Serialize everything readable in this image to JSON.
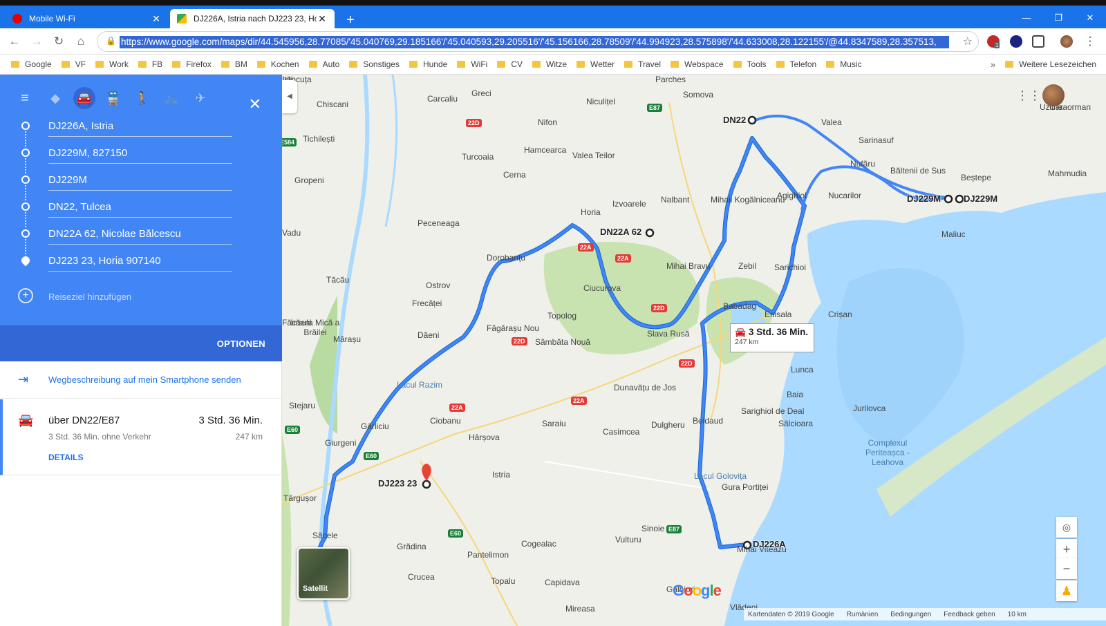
{
  "browser": {
    "tabs": [
      {
        "title": "Mobile Wi-Fi",
        "icon": "vodafone-icon",
        "active": false
      },
      {
        "title": "DJ226A, Istria nach DJ223 23, Ho",
        "icon": "google-maps-icon",
        "active": true
      }
    ],
    "url": "https://www.google.com/maps/dir/44.545956,28.77085/'45.040769,29.185166'/'45.040593,29.205516'/'45.156166,28.78509'/'44.994923,28.575898'/'44.633008,28.122155'/@44.8347589,28.357513,",
    "extension_badge": "1"
  },
  "bookmarks": [
    "Google",
    "VF",
    "Work",
    "FB",
    "Firefox",
    "BM",
    "Kochen",
    "Auto",
    "Sonstiges",
    "Hunde",
    "WiFi",
    "CV",
    "Witze",
    "Wetter",
    "Travel",
    "Webspace",
    "Tools",
    "Telefon",
    "Music"
  ],
  "bookmarks_overflow": "»",
  "bookmarks_other": "Weitere Lesezeichen",
  "directions": {
    "stops": [
      "DJ226A, Istria",
      "DJ229M, 827150",
      "DJ229M",
      "DN22, Tulcea",
      "DN22A 62, Nicolae Bălcescu",
      "DJ223 23, Horia 907140"
    ],
    "add_destination_placeholder": "Reiseziel hinzufügen",
    "options_label": "OPTIONEN",
    "send_to_phone": "Wegbeschreibung auf mein Smartphone senden",
    "route": {
      "via": "über DN22/E87",
      "time": "3 Std. 36 Min.",
      "subtitle": "3 Std. 36 Min. ohne Verkehr",
      "distance": "247 km",
      "details_label": "DETAILS"
    }
  },
  "map": {
    "route_color": "#4285f4",
    "water_color": "#aadaff",
    "info_time": "3 Std. 36 Min.",
    "info_distance": "247 km",
    "waypoint_labels": [
      "DN22",
      "DN22A 62",
      "DJ229M",
      "DJ229M",
      "DJ223 23",
      "DJ226A"
    ],
    "place_labels": [
      "Parches",
      "Somova",
      "Niculițel",
      "Greci",
      "Carcaliu",
      "Chiscani",
      "Tichilești",
      "Nifon",
      "Hamcearca",
      "Valea Teilor",
      "Turcoaia",
      "Gropeni",
      "Cerna",
      "Horia",
      "Izvoarele",
      "Nalbant",
      "Mihail Kogălniceanu",
      "Peceneaga",
      "Dorobanțu",
      "Mihai Bravu",
      "Zebil",
      "Ciucurova",
      "Ostrov",
      "Frecăței",
      "Tăcău",
      "Insula Mică a Brăilei",
      "Mărașu",
      "Făgărașu Nou",
      "Topolog",
      "Dăeni",
      "Sâmbăta Nouă",
      "Slava Rusă",
      "Babadag",
      "Enisala",
      "Sarichioi",
      "Agighiol",
      "Nucarilor",
      "Valea",
      "Sarinasuf",
      "Nufăru",
      "Băltenii de Sus",
      "Beștepe",
      "Mahmudia",
      "Uzlina",
      "Caraorman",
      "Maliuc",
      "Crișan",
      "Dunavățu de Jos",
      "Lacul Razim",
      "Stejaru",
      "Gârliciu",
      "Giurgeni",
      "Ciobanu",
      "Hârșova",
      "Saraiu",
      "Dulgheru",
      "Casimcea",
      "Beidaud",
      "Sarighiol de Deal",
      "Baia",
      "Lunca",
      "Jurilovca",
      "Sălcioara",
      "Complexul Periteașca - Leahova",
      "Lacul Golovița",
      "Gura Portiței",
      "Mihai Viteazu",
      "Sinoie",
      "Istria",
      "Cogealac",
      "Vulturu",
      "Pantelimon",
      "Grădina",
      "Crucea",
      "Topalu",
      "Capidava",
      "Gălbiori",
      "Mireasa",
      "Târgușor",
      "Săcele",
      "Vlădeni",
      "Făcăeni",
      "Vadu",
      "Ițăncuța",
      "Iști"
    ],
    "road_badges_red": [
      "22D",
      "22A",
      "22A",
      "22D",
      "22D",
      "22D",
      "22A",
      "22A"
    ],
    "road_badges_green": [
      "E87",
      "E584",
      "E60",
      "E60",
      "E60",
      "E87"
    ],
    "satellite_label": "Satellit",
    "google_logo": "Google",
    "footer": [
      "Kartendaten © 2019 Google",
      "Rumänien",
      "Bedingungen",
      "Feedback geben",
      "10 km"
    ]
  }
}
